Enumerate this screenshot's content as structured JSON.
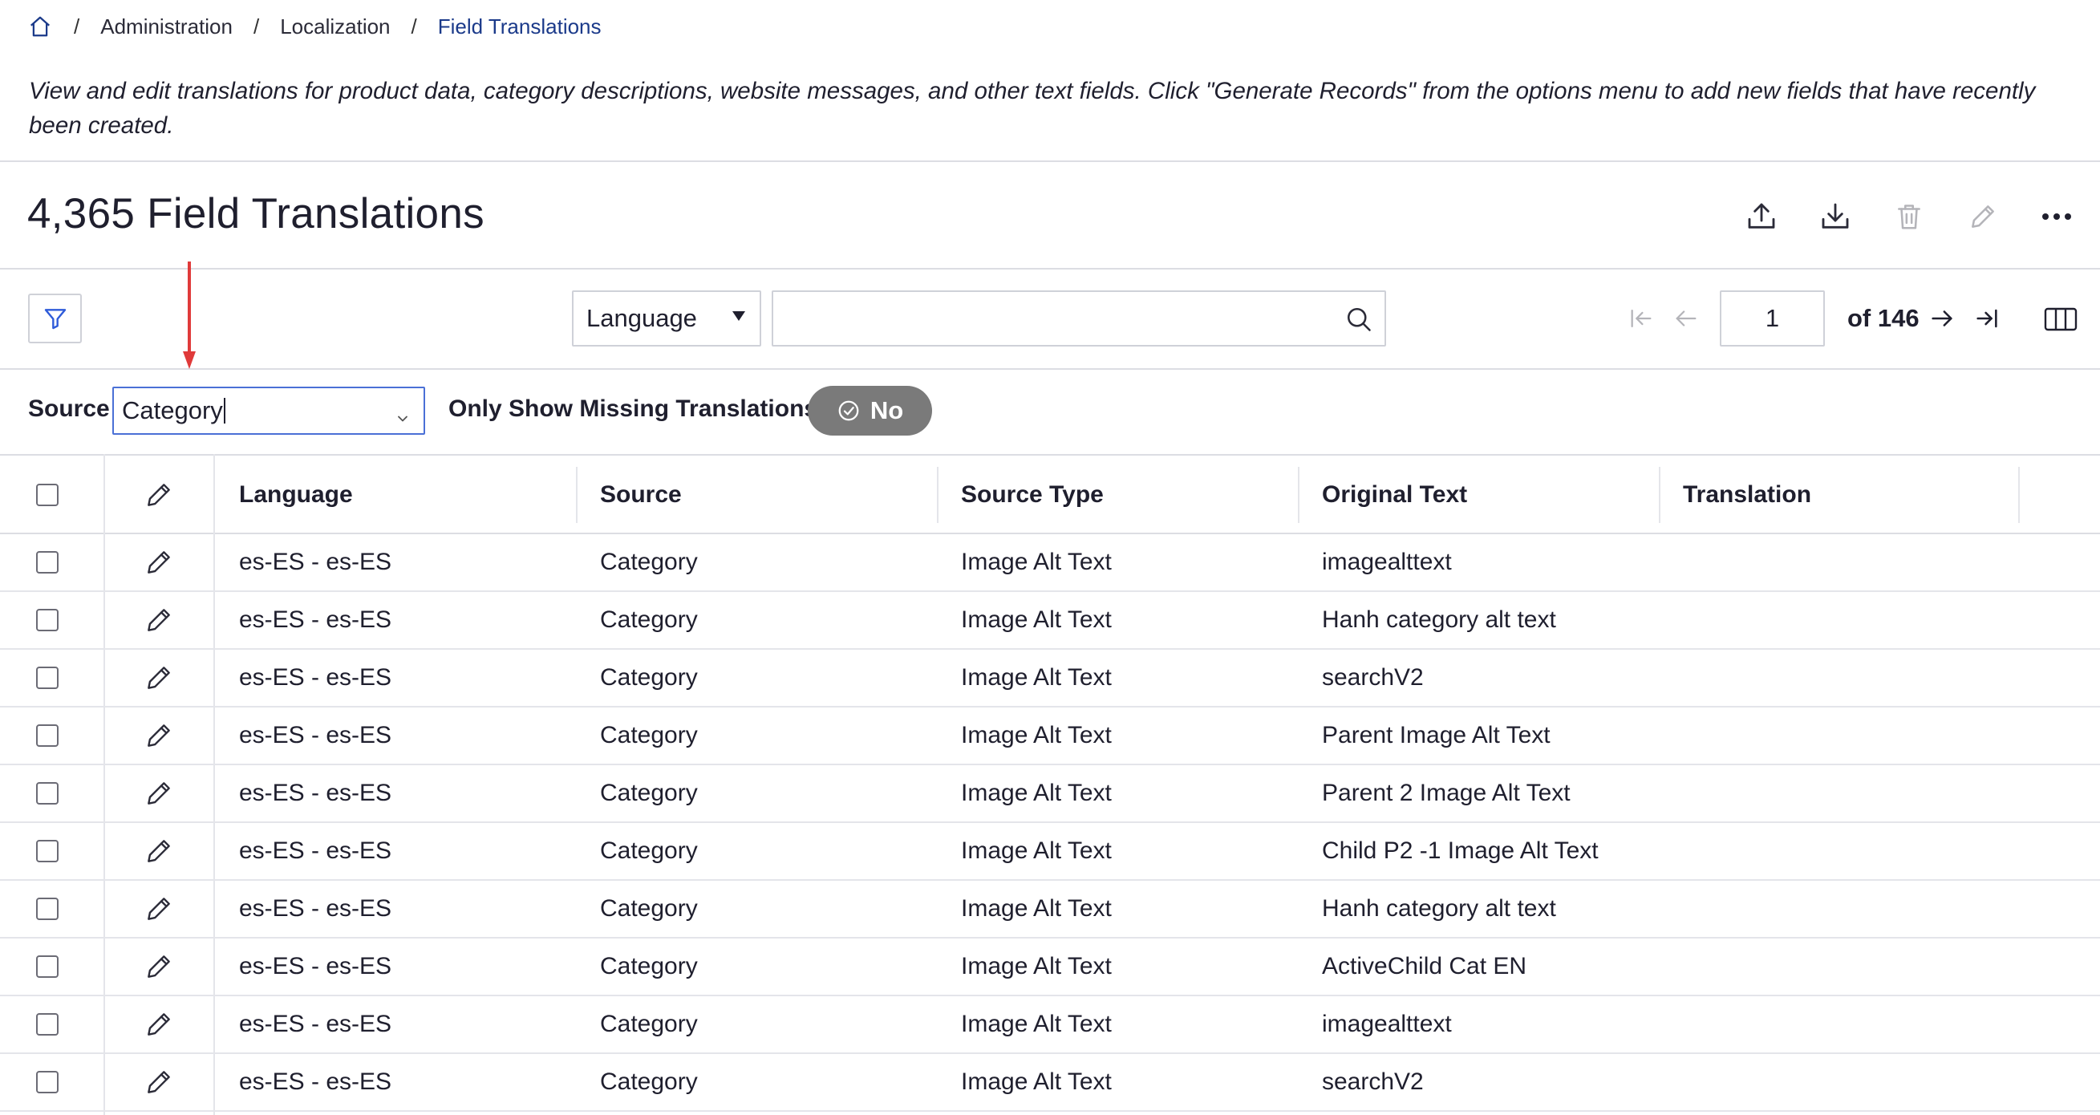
{
  "breadcrumb": {
    "items": [
      "Administration",
      "Localization",
      "Field Translations"
    ],
    "separator": "/"
  },
  "description": "View and edit translations for product data, category descriptions, website messages, and other text fields. Click \"Generate Records\" from the options menu to add new fields that have recently been created.",
  "header": {
    "title": "4,365 Field Translations",
    "actions": [
      "upload-icon",
      "download-icon",
      "trash-icon",
      "pencil-icon",
      "more-icon"
    ]
  },
  "filters": {
    "search_field_selected": "Language",
    "search_value": "",
    "source_label": "Source",
    "source_value": "Category",
    "missing_label": "Only Show Missing Translations",
    "missing_toggle": "No"
  },
  "pagination": {
    "current_page": "1",
    "of_label": "of 146"
  },
  "table": {
    "columns": [
      "Language",
      "Source",
      "Source Type",
      "Original Text",
      "Translation"
    ],
    "rows": [
      {
        "language": "es-ES - es-ES",
        "source": "Category",
        "source_type": "Image Alt Text",
        "original": "imagealttext",
        "translation": ""
      },
      {
        "language": "es-ES - es-ES",
        "source": "Category",
        "source_type": "Image Alt Text",
        "original": "Hanh category alt text",
        "translation": ""
      },
      {
        "language": "es-ES - es-ES",
        "source": "Category",
        "source_type": "Image Alt Text",
        "original": "searchV2",
        "translation": ""
      },
      {
        "language": "es-ES - es-ES",
        "source": "Category",
        "source_type": "Image Alt Text",
        "original": "Parent Image Alt Text",
        "translation": ""
      },
      {
        "language": "es-ES - es-ES",
        "source": "Category",
        "source_type": "Image Alt Text",
        "original": "Parent 2 Image Alt Text",
        "translation": ""
      },
      {
        "language": "es-ES - es-ES",
        "source": "Category",
        "source_type": "Image Alt Text",
        "original": "Child P2 -1 Image Alt Text",
        "translation": ""
      },
      {
        "language": "es-ES - es-ES",
        "source": "Category",
        "source_type": "Image Alt Text",
        "original": "Hanh category alt text",
        "translation": ""
      },
      {
        "language": "es-ES - es-ES",
        "source": "Category",
        "source_type": "Image Alt Text",
        "original": "ActiveChild Cat EN",
        "translation": ""
      },
      {
        "language": "es-ES - es-ES",
        "source": "Category",
        "source_type": "Image Alt Text",
        "original": "imagealttext",
        "translation": ""
      },
      {
        "language": "es-ES - es-ES",
        "source": "Category",
        "source_type": "Image Alt Text",
        "original": "searchV2",
        "translation": ""
      }
    ]
  },
  "colors": {
    "link": "#1b3a8a",
    "focus_border": "#4a70d6",
    "toggle_bg": "#7a7a7a",
    "annotation_arrow": "#e03a3a"
  }
}
